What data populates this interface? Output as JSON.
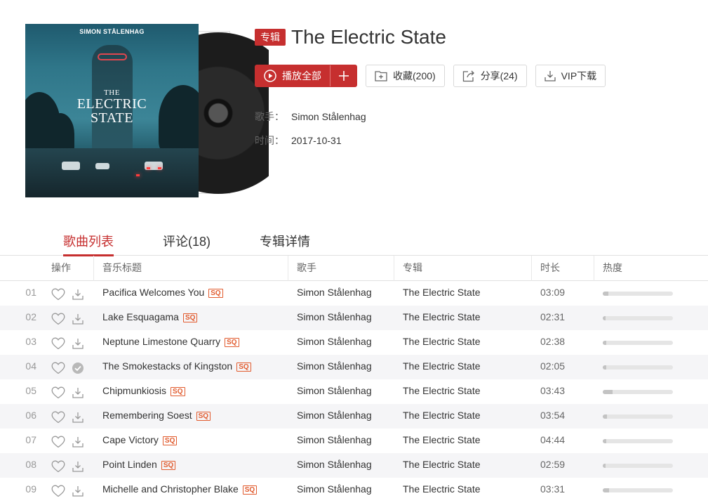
{
  "album": {
    "tag": "专辑",
    "title": "The Electric State",
    "cover_author": "SIMON STÅLENHAG",
    "cover_the": "THE",
    "cover_title_line1": "ELECTRIC",
    "cover_title_line2": "STATE",
    "artist_label": "歌手：",
    "artist": "Simon Stålenhag",
    "date_label": "时间：",
    "date": "2017-10-31"
  },
  "actions": {
    "play_all": "播放全部",
    "play_all_add_icon": "plus-icon",
    "collect": "收藏(200)",
    "share": "分享(24)",
    "vip_download": "VIP下载"
  },
  "tabs": [
    {
      "label": "歌曲列表",
      "active": true
    },
    {
      "label": "评论(18)",
      "active": false
    },
    {
      "label": "专辑详情",
      "active": false
    }
  ],
  "table": {
    "headers": {
      "ops": "操作",
      "title": "音乐标题",
      "artist": "歌手",
      "album": "专辑",
      "duration": "时长",
      "heat": "热度"
    },
    "quality_badge": "SQ",
    "rows": [
      {
        "num": "01",
        "title": "Pacifica Welcomes You",
        "artist": "Simon Stålenhag",
        "album": "The Electric State",
        "duration": "03:09",
        "heat": 0.08,
        "downloaded": false
      },
      {
        "num": "02",
        "title": "Lake Esquagama",
        "artist": "Simon Stålenhag",
        "album": "The Electric State",
        "duration": "02:31",
        "heat": 0.04,
        "downloaded": false
      },
      {
        "num": "03",
        "title": "Neptune Limestone Quarry",
        "artist": "Simon Stålenhag",
        "album": "The Electric State",
        "duration": "02:38",
        "heat": 0.05,
        "downloaded": false
      },
      {
        "num": "04",
        "title": "The Smokestacks of Kingston",
        "artist": "Simon Stålenhag",
        "album": "The Electric State",
        "duration": "02:05",
        "heat": 0.05,
        "downloaded": true
      },
      {
        "num": "05",
        "title": "Chipmunkiosis",
        "artist": "Simon Stålenhag",
        "album": "The Electric State",
        "duration": "03:43",
        "heat": 0.14,
        "downloaded": false
      },
      {
        "num": "06",
        "title": "Remembering Soest",
        "artist": "Simon Stålenhag",
        "album": "The Electric State",
        "duration": "03:54",
        "heat": 0.06,
        "downloaded": false
      },
      {
        "num": "07",
        "title": "Cape Victory",
        "artist": "Simon Stålenhag",
        "album": "The Electric State",
        "duration": "04:44",
        "heat": 0.05,
        "downloaded": false
      },
      {
        "num": "08",
        "title": "Point Linden",
        "artist": "Simon Stålenhag",
        "album": "The Electric State",
        "duration": "02:59",
        "heat": 0.04,
        "downloaded": false
      },
      {
        "num": "09",
        "title": "Michelle and Christopher Blake",
        "artist": "Simon Stålenhag",
        "album": "The Electric State",
        "duration": "03:31",
        "heat": 0.09,
        "downloaded": false
      }
    ]
  },
  "colors": {
    "accent": "#c62f2f",
    "sq_badge": "#e15b2e"
  }
}
